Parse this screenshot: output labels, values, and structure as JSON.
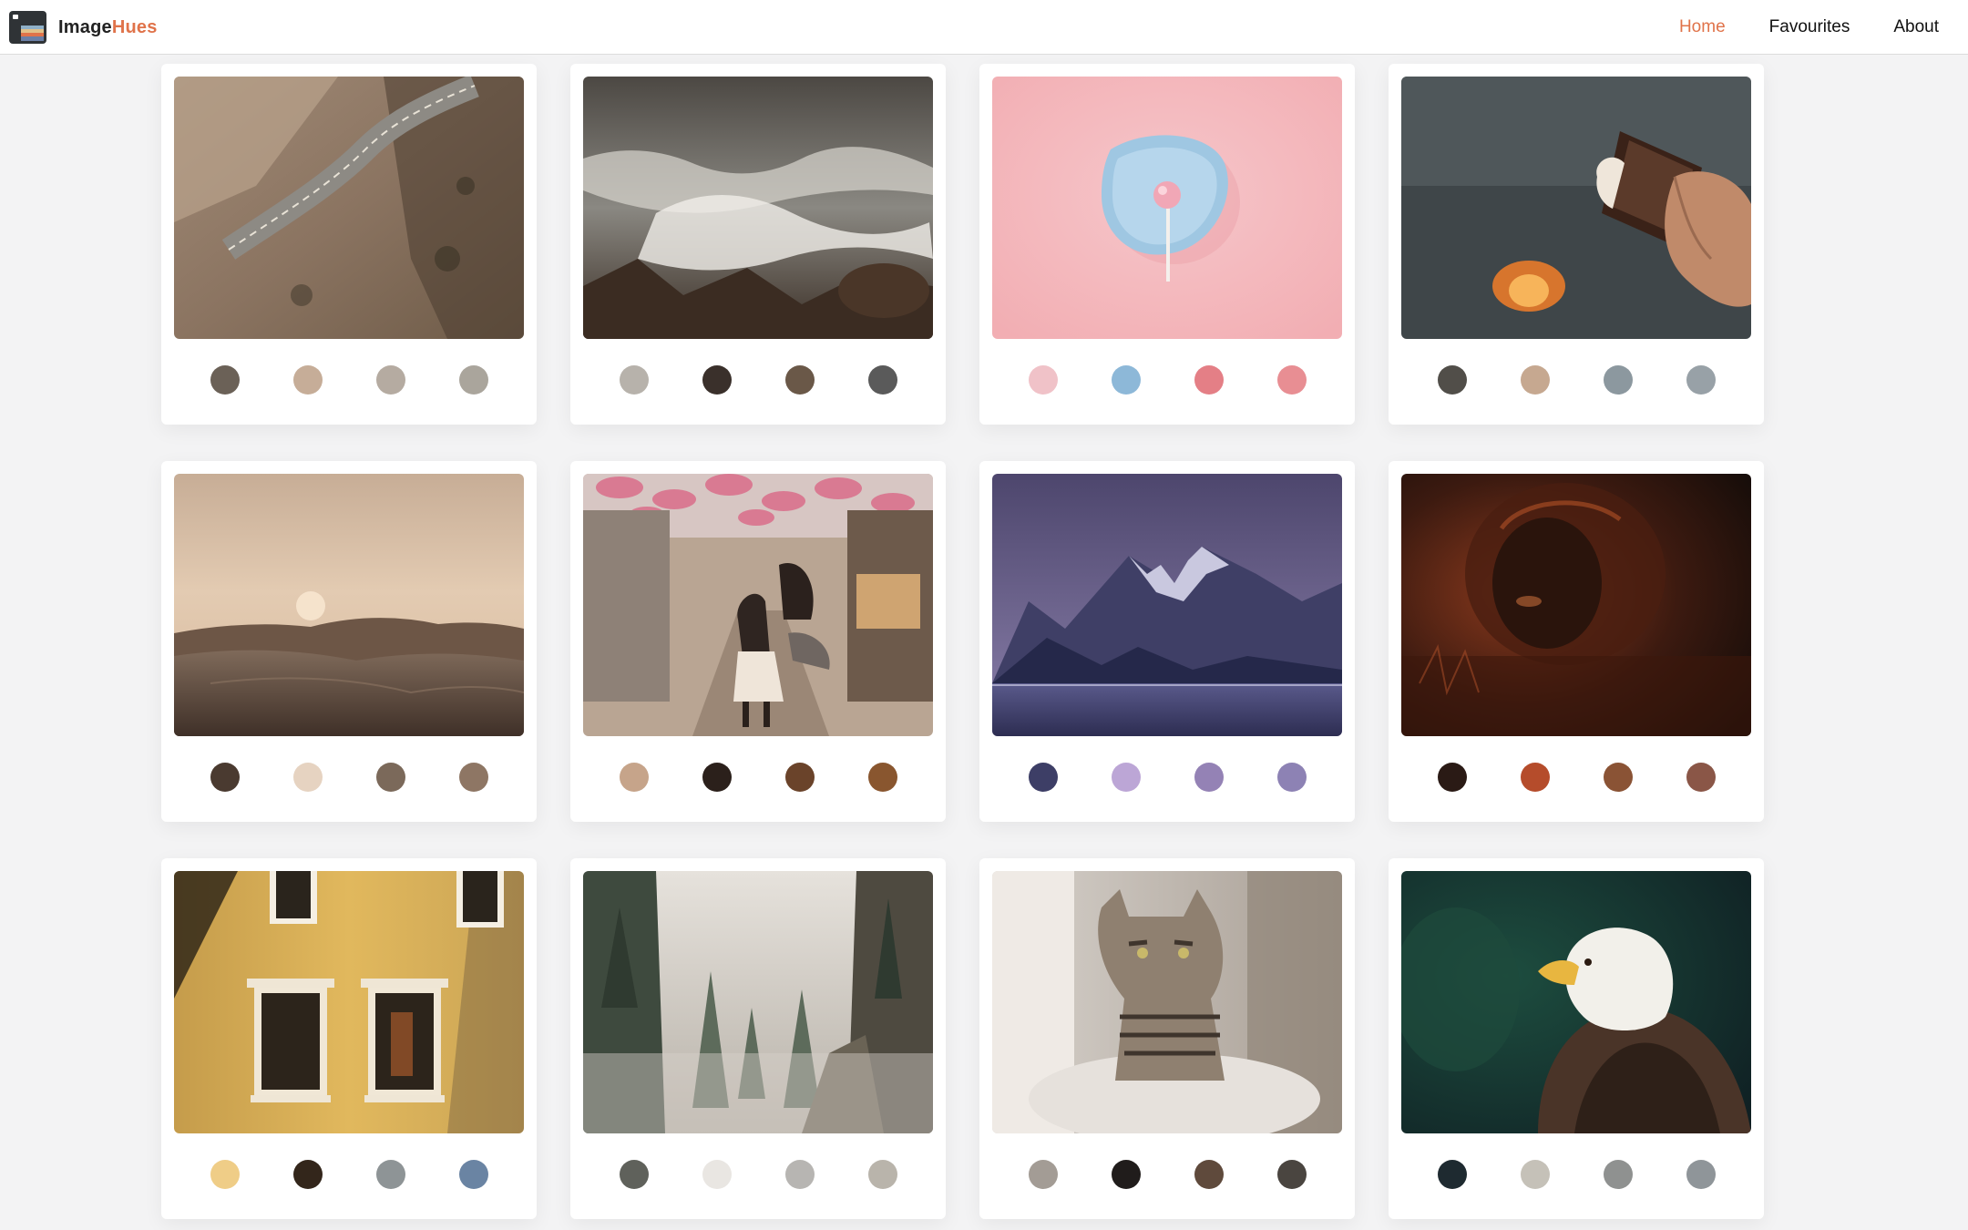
{
  "app": {
    "brand_part1": "Image",
    "brand_part2": "Hues",
    "accent": "#e0734a"
  },
  "nav": {
    "items": [
      {
        "label": "Home",
        "active": true
      },
      {
        "label": "Favourites",
        "active": false
      },
      {
        "label": "About",
        "active": false
      }
    ]
  },
  "gallery": {
    "cards": [
      {
        "subject": "mountain-road",
        "swatches": [
          "#6b6157",
          "#c6ad98",
          "#b5aba1",
          "#aaa59c"
        ]
      },
      {
        "subject": "ocean-waves",
        "swatches": [
          "#b7b2ab",
          "#3a302b",
          "#6a5848",
          "#5a5a5a"
        ]
      },
      {
        "subject": "lollipop",
        "swatches": [
          "#f0c2c8",
          "#8db8d8",
          "#e47f86",
          "#e88e93"
        ]
      },
      {
        "subject": "smores",
        "swatches": [
          "#514e49",
          "#c6a890",
          "#8c989f",
          "#98a1a7"
        ]
      },
      {
        "subject": "desert-dunes",
        "swatches": [
          "#4a3a30",
          "#e6d3c1",
          "#7b695a",
          "#8e7664"
        ]
      },
      {
        "subject": "umbrella-street",
        "swatches": [
          "#c6a48a",
          "#2b201b",
          "#6a432a",
          "#89562f"
        ]
      },
      {
        "subject": "mountain-lake",
        "swatches": [
          "#3d3e66",
          "#bca6d6",
          "#9482b5",
          "#8d82b4"
        ]
      },
      {
        "subject": "lion",
        "swatches": [
          "#2a1a15",
          "#b54c2b",
          "#8a5335",
          "#8a5647"
        ]
      },
      {
        "subject": "yellow-building",
        "swatches": [
          "#efcd87",
          "#33261b",
          "#8e9496",
          "#6a84a3"
        ]
      },
      {
        "subject": "misty-forest",
        "swatches": [
          "#5f615b",
          "#e9e6e2",
          "#b7b5b2",
          "#b9b4ab"
        ]
      },
      {
        "subject": "tabby-cat",
        "swatches": [
          "#a39c95",
          "#201c1b",
          "#5f4a3c",
          "#4a4540"
        ]
      },
      {
        "subject": "bald-eagle",
        "swatches": [
          "#1e2a30",
          "#c5c1b8",
          "#8f9190",
          "#8f9599"
        ]
      }
    ]
  }
}
